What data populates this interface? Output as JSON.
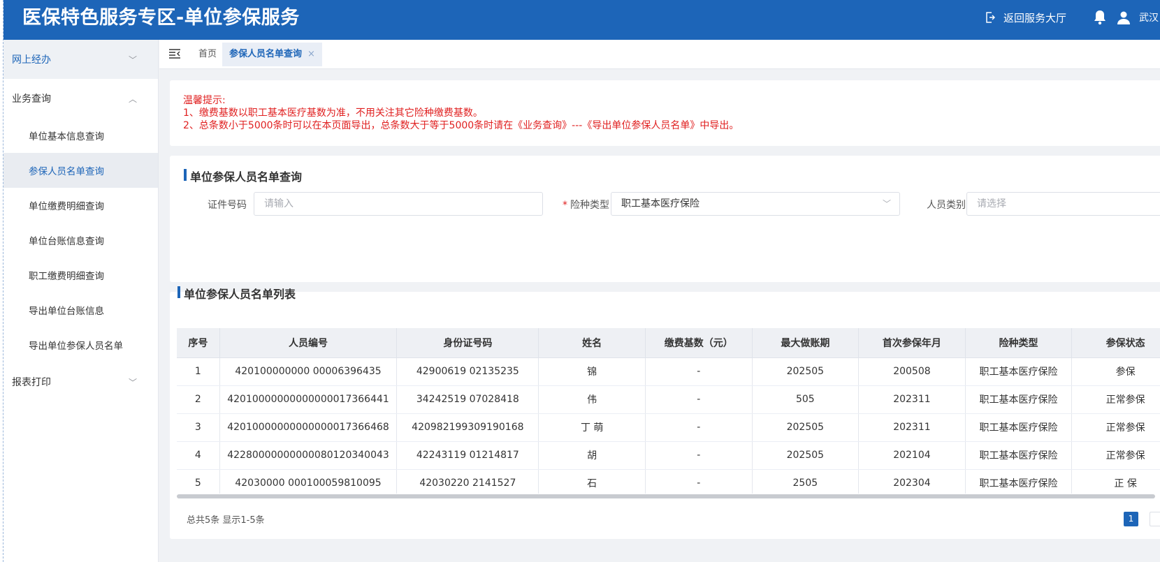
{
  "header": {
    "title": "医保特色服务专区-单位参保服务",
    "return_label": "返回服务大厅",
    "user_name": "武汉"
  },
  "sidebar": {
    "groups": [
      {
        "label": "网上经办"
      },
      {
        "label": "业务查询"
      },
      {
        "label": "报表打印"
      }
    ],
    "items": [
      {
        "label": "单位基本信息查询"
      },
      {
        "label": "参保人员名单查询"
      },
      {
        "label": "单位缴费明细查询"
      },
      {
        "label": "单位台账信息查询"
      },
      {
        "label": "职工缴费明细查询"
      },
      {
        "label": "导出单位台账信息"
      },
      {
        "label": "导出单位参保人员名单"
      }
    ]
  },
  "tabs": {
    "home": "首页",
    "active": "参保人员名单查询",
    "close": "×"
  },
  "notice": {
    "title": "温馨提示:",
    "line1": "1、缴费基数以职工基本医疗基数为准，不用关注其它险种缴费基数。",
    "line2": "2、总条数小于5000条时可以在本页面导出，总条数大于等于5000条时请在《业务查询》---《导出单位参保人员名单》中导出。"
  },
  "search": {
    "title": "单位参保人员名单查询",
    "id_label": "证件号码",
    "id_placeholder": "请输入",
    "insurance_label": "险种类型",
    "insurance_required": "*",
    "insurance_value": "职工基本医疗保险",
    "category_label": "人员类别",
    "category_placeholder": "请选择"
  },
  "list": {
    "title": "单位参保人员名单列表",
    "columns": [
      "序号",
      "人员编号",
      "身份证号码",
      "姓名",
      "缴费基数（元）",
      "最大做账期",
      "首次参保年月",
      "险种类型",
      "参保状态"
    ],
    "rows": [
      [
        "1",
        "420100000000   00006396435",
        "42900619   02135235",
        "  锦",
        "-",
        "202505",
        "200508",
        "职工基本医疗保险",
        "参保"
      ],
      [
        "2",
        "42010000000000000017366441",
        "34242519   07028418",
        "  伟",
        "-",
        "505",
        "202311",
        "职工基本医疗保险",
        "正常参保"
      ],
      [
        "3",
        "42010000000000000017366468",
        "420982199309190168",
        "丁  萌",
        "-",
        "202505",
        "202311",
        "职工基本医疗保险",
        "正常参保"
      ],
      [
        "4",
        "42280000000000080120340043",
        "42243119   01214817",
        "胡",
        "-",
        "202505",
        "202104",
        "职工基本医疗保险",
        "正常参保"
      ],
      [
        "5",
        "42030000   000100059810095",
        "42030220   2141527",
        "石",
        "-",
        "2505",
        "202304",
        "职工基本医疗保险",
        "正   保"
      ]
    ],
    "summary": "总共5条 显示1-5条",
    "current_page": "1"
  },
  "colors": {
    "brand": "#1d65b8",
    "notice_red": "#e02020"
  }
}
